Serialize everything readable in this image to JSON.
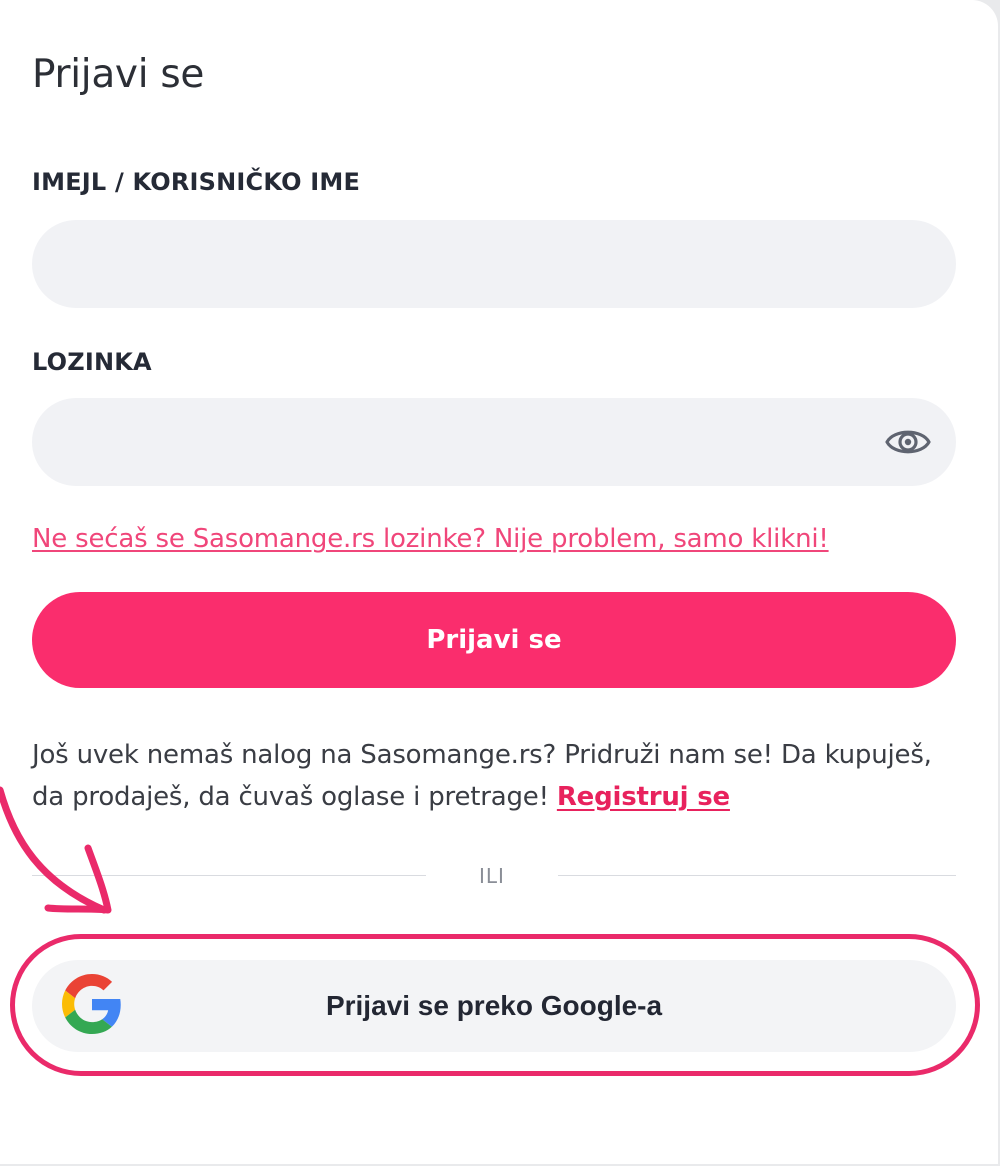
{
  "form": {
    "title": "Prijavi se",
    "email_label": "IMEJL / KORISNIČKO IME",
    "email_value": "",
    "email_placeholder": "",
    "password_label": "LOZINKA",
    "password_value": "",
    "password_placeholder": "",
    "show_password_icon": "eye-icon",
    "forgot_link": "Ne sećaš se Sasomange.rs lozinke? Nije problem, samo klikni!",
    "submit_label": "Prijavi se",
    "info_text": "Još uvek nemaš nalog na Sasomange.rs? Pridruži nam se! Da kupuješ, da prodaješ, da čuvaš oglase i pretrage! ",
    "register_link": "Registruj se",
    "divider_text": "ILI",
    "google_label": "Prijavi se preko Google-a",
    "google_icon": "google-icon"
  },
  "annotation": {
    "arrow_icon": "arrow-icon",
    "highlight": "highlight-ring"
  },
  "colors": {
    "accent": "#fa2d6d",
    "link": "#f0467a",
    "input_bg": "#f1f2f5",
    "annotation": "#ea2a6a"
  }
}
